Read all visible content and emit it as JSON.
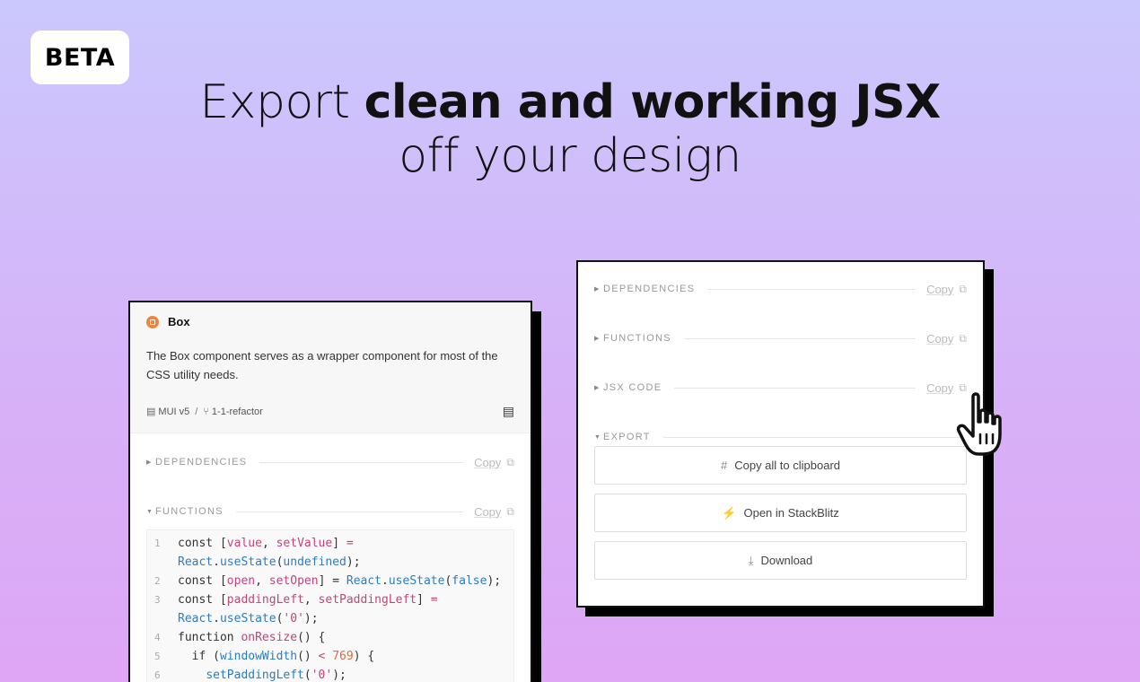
{
  "badge": "BETA",
  "headline": {
    "lead": "Export ",
    "bold": "clean and working JSX",
    "line2": "off your design"
  },
  "left_panel": {
    "component_name": "Box",
    "description": "The Box component serves as a wrapper component for most of the CSS utility needs.",
    "library": "MUI v5",
    "branch": "1-1-refactor",
    "sections": {
      "dependencies": "DEPENDENCIES",
      "functions": "FUNCTIONS"
    },
    "copy_label": "Copy",
    "code_lines": [
      {
        "num": "1",
        "text": "const [value, setValue] ="
      },
      {
        "num": "",
        "text": "React.useState(undefined);"
      },
      {
        "num": "2",
        "text": "const [open, setOpen] = React.useState(false);"
      },
      {
        "num": "3",
        "text": "const [paddingLeft, setPaddingLeft] ="
      },
      {
        "num": "",
        "text": "React.useState('0');"
      },
      {
        "num": "4",
        "text": "function onResize() {"
      },
      {
        "num": "5",
        "text": "  if (windowWidth() < 769) {"
      },
      {
        "num": "6",
        "text": "    setPaddingLeft('0');"
      }
    ]
  },
  "right_panel": {
    "sections": {
      "dependencies": "DEPENDENCIES",
      "functions": "FUNCTIONS",
      "jsx_code": "JSX CODE",
      "export": "EXPORT"
    },
    "copy_label": "Copy",
    "buttons": {
      "copy_all": "Copy all to clipboard",
      "stackblitz": "Open in StackBlitz",
      "download": "Download"
    }
  },
  "icons": {
    "component": "box-icon",
    "library": "library-icon",
    "branch": "branch-icon",
    "docs": "docs-icon",
    "copy": "copy-icon",
    "hash": "hash-icon",
    "bolt": "bolt-icon",
    "download": "download-icon",
    "cursor": "hand-cursor-icon"
  }
}
